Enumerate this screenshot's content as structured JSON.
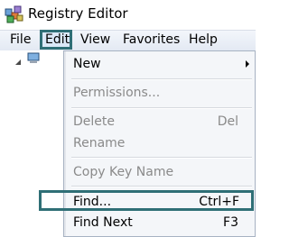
{
  "window": {
    "title": "Registry Editor",
    "app_icon": "registry-editor-icon"
  },
  "menubar": {
    "items": [
      {
        "label": "File"
      },
      {
        "label": "Edit",
        "open": true
      },
      {
        "label": "View"
      },
      {
        "label": "Favorites"
      },
      {
        "label": "Help"
      }
    ]
  },
  "tree": {
    "root_icon": "computer-icon",
    "expanded": true
  },
  "edit_menu": {
    "items": [
      {
        "label": "New",
        "shortcut": "",
        "enabled": true,
        "submenu": true
      },
      {
        "label": "Permissions...",
        "shortcut": "",
        "enabled": false
      },
      {
        "label": "Delete",
        "shortcut": "Del",
        "enabled": false
      },
      {
        "label": "Rename",
        "shortcut": "",
        "enabled": false
      },
      {
        "label": "Copy Key Name",
        "shortcut": "",
        "enabled": false
      },
      {
        "label": "Find...",
        "shortcut": "Ctrl+F",
        "enabled": true,
        "highlighted": true
      },
      {
        "label": "Find Next",
        "shortcut": "F3",
        "enabled": true
      }
    ]
  },
  "colors": {
    "highlight_outline": "#2f6f76",
    "disabled_text": "#8a8a8a",
    "menu_background": "#f4f6f9"
  }
}
